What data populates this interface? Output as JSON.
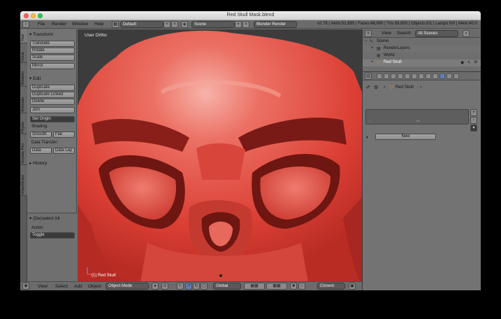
{
  "window": {
    "title": "Red Skull Mask.blend"
  },
  "menubar": {
    "items": [
      "File",
      "Render",
      "Window",
      "Help"
    ],
    "layout": "Default",
    "scene": "Scene",
    "engine": "Blender Render",
    "stats": "v2.78 | Verts:51,893 | Faces:46,800 | Tris:93,600 | Objects:0/1 | Lamps:0/0 | Mem:40.0"
  },
  "tabs": [
    "Tool",
    "Creat",
    "Relation",
    "Animatio",
    "Physic",
    "Grease Pen",
    "ImportExpo"
  ],
  "toolshelf": {
    "transform_header": "Transform",
    "transform_buttons": [
      "Translate",
      "Rotate",
      "Scale",
      "Mirror"
    ],
    "edit_header": "Edit",
    "edit_buttons": [
      "Duplicate",
      "Duplicate Linked",
      "Delete",
      "Join"
    ],
    "set_origin": "Set Origin",
    "shading_label": "Shading:",
    "smooth": "Smooth",
    "flat": "Flat",
    "data_transfer_label": "Data Transfer:",
    "data": "Data",
    "data_lay": "Data Lay",
    "history_header": "History",
    "deselect_header": "(De)select All",
    "action_label": "Action",
    "action_value": "Toggle"
  },
  "viewport": {
    "view_label": "User Ortho",
    "object_label": "(1) Red Skull"
  },
  "bottombar": {
    "items": [
      "View",
      "Select",
      "Add",
      "Object"
    ],
    "mode": "Object Mode",
    "pivot": "Global",
    "snap": "Closest"
  },
  "outliner": {
    "header_items": [
      "View",
      "Search"
    ],
    "filter": "All Scenes",
    "rows": [
      "Scene",
      "RenderLayers",
      "World",
      "Red Skull"
    ]
  },
  "properties": {
    "object_name": "Red Skull",
    "new_button": "New"
  },
  "colors": {
    "skull": "#e24a3e",
    "skull_highlight": "#f6a79c",
    "skull_shadow": "#7a1a16",
    "accent": "#5e7fb8"
  }
}
